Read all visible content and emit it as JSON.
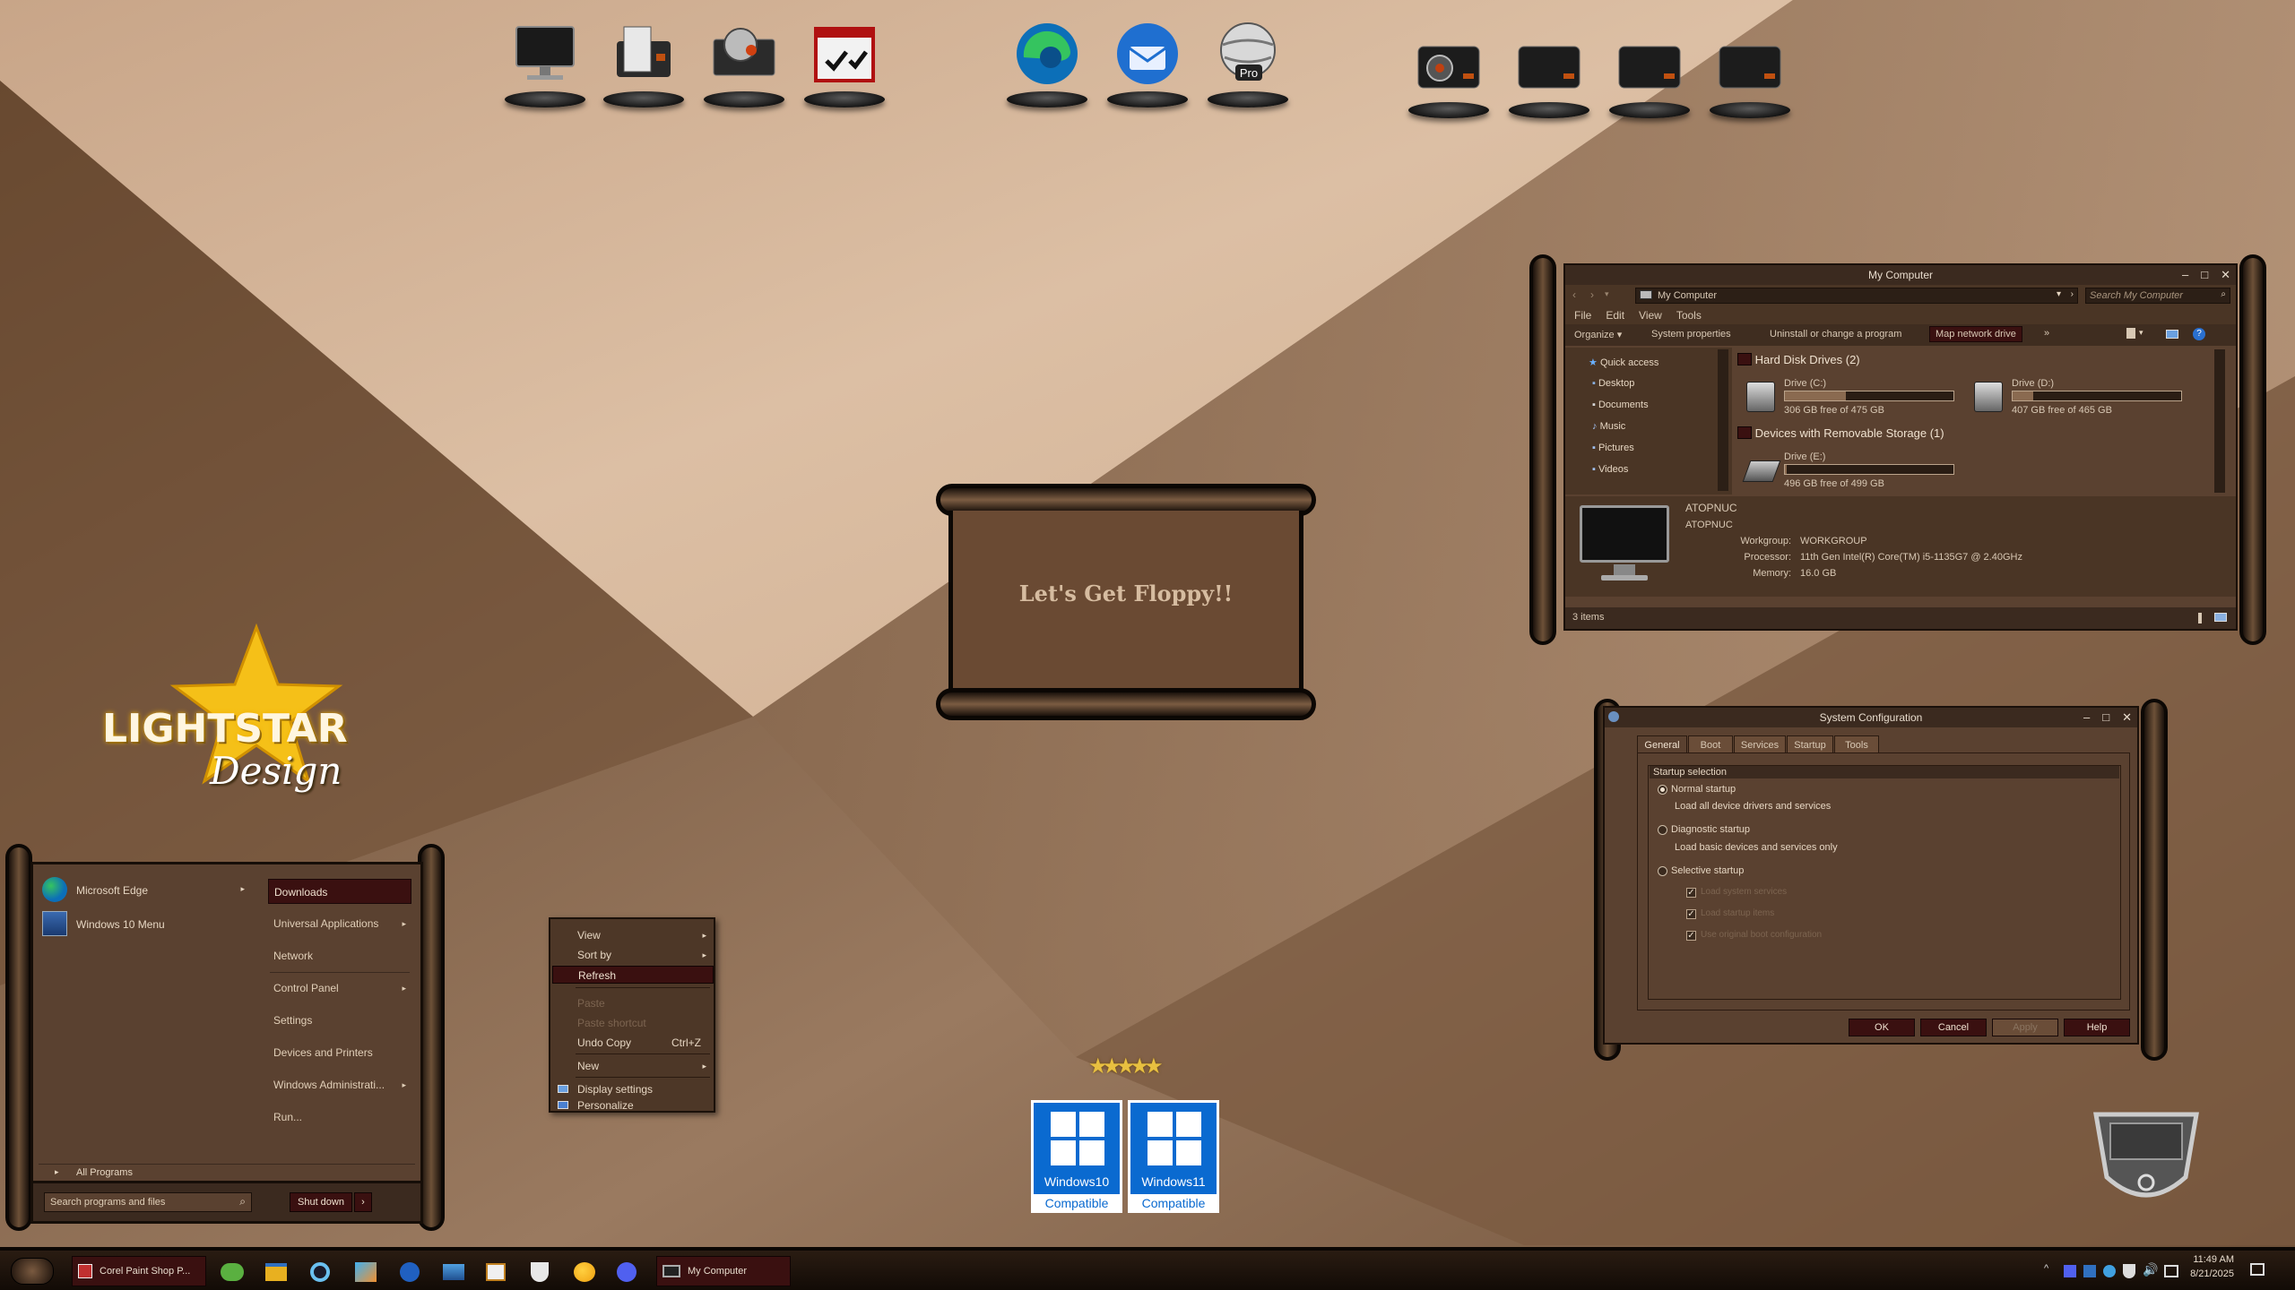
{
  "dock": {
    "left_group": [
      "computer-icon",
      "document-printer-icon",
      "satellite-dish-icon",
      "checklist-app-icon"
    ],
    "center_group": [
      "microsoft-edge-icon",
      "thunderbird-icon",
      "google-earth-pro-icon"
    ],
    "center_labels": {
      "earth_badge": "Pro"
    },
    "right_group": [
      "drive-record-icon",
      "drive-icon",
      "drive-icon",
      "drive-icon"
    ]
  },
  "banner": {
    "text": "Let's Get Floppy!!"
  },
  "logo": {
    "line1": "LIGHTSTAR",
    "line2": "Design"
  },
  "badges": [
    {
      "line1": "Windows10",
      "line2": "Compatible"
    },
    {
      "line1": "Windows11",
      "line2": "Compatible"
    }
  ],
  "explorer": {
    "title": "My Computer",
    "address": "My Computer",
    "search_placeholder": "Search My Computer",
    "menu": [
      "File",
      "Edit",
      "View",
      "Tools"
    ],
    "toolbar": [
      "Organize ▾",
      "System properties",
      "Uninstall or change a program",
      "Map network drive",
      "»"
    ],
    "nav": [
      "Quick access",
      "Desktop",
      "Documents",
      "Music",
      "Pictures",
      "Videos"
    ],
    "group_hdd": "Hard Disk Drives (2)",
    "group_removable": "Devices with Removable Storage (1)",
    "drives": [
      {
        "name": "Drive (C:)",
        "free": "306 GB free of 475 GB",
        "used_fraction": 0.36
      },
      {
        "name": "Drive (D:)",
        "free": "407 GB free of 465 GB",
        "used_fraction": 0.12
      },
      {
        "name": "Drive (E:)",
        "free": "496 GB free of 499 GB",
        "used_fraction": 0.01
      }
    ],
    "details": {
      "pc_name": "ATOPNUC",
      "pc_name2": "ATOPNUC",
      "workgroup_label": "Workgroup:",
      "workgroup": "WORKGROUP",
      "processor_label": "Processor:",
      "processor": "11th Gen Intel(R) Core(TM) i5-1135G7 @ 2.40GHz",
      "memory_label": "Memory:",
      "memory": "16.0 GB"
    },
    "status": "3 items"
  },
  "sysconfig": {
    "title": "System Configuration",
    "tabs": [
      "General",
      "Boot",
      "Services",
      "Startup",
      "Tools"
    ],
    "group_label": "Startup selection",
    "normal": "Normal startup",
    "normal_desc": "Load all device drivers and services",
    "diagnostic": "Diagnostic startup",
    "diagnostic_desc": "Load basic devices and services only",
    "selective": "Selective startup",
    "selective_opts": [
      "Load system services",
      "Load startup items",
      "Use original boot configuration"
    ],
    "buttons": {
      "ok": "OK",
      "cancel": "Cancel",
      "apply": "Apply",
      "help": "Help"
    }
  },
  "start_menu": {
    "pinned": [
      {
        "label": "Microsoft Edge",
        "icon": "microsoft-edge-icon",
        "has_arrow": true
      },
      {
        "label": "Windows 10 Menu",
        "icon": "windows-menu-icon",
        "has_arrow": false
      }
    ],
    "right": [
      {
        "label": "Downloads",
        "arrow": "",
        "highlighted": true
      },
      {
        "label": "Universal Applications",
        "arrow": "▸"
      },
      {
        "label": "Network",
        "arrow": ""
      },
      {
        "label": "Control Panel",
        "arrow": "▸"
      },
      {
        "label": "Settings",
        "arrow": ""
      },
      {
        "label": "Devices and Printers",
        "arrow": ""
      },
      {
        "label": "Windows Administrati...",
        "arrow": "▸"
      },
      {
        "label": "Run...",
        "arrow": ""
      }
    ],
    "all_programs": "All Programs",
    "search_placeholder": "Search programs and files",
    "shutdown": "Shut down"
  },
  "context_menu": {
    "items": [
      {
        "label": "View",
        "arrow": "▸",
        "shortcut": "",
        "disabled": false
      },
      {
        "label": "Sort by",
        "arrow": "▸",
        "shortcut": "",
        "disabled": false
      },
      {
        "label": "Refresh",
        "arrow": "",
        "shortcut": "",
        "disabled": false,
        "highlighted": true
      },
      {
        "label": "Paste",
        "arrow": "",
        "shortcut": "",
        "disabled": true
      },
      {
        "label": "Paste shortcut",
        "arrow": "",
        "shortcut": "",
        "disabled": true
      },
      {
        "label": "Undo Copy",
        "arrow": "",
        "shortcut": "Ctrl+Z",
        "disabled": false
      },
      {
        "label": "New",
        "arrow": "▸",
        "shortcut": "",
        "disabled": false
      },
      {
        "label": "Display settings",
        "arrow": "",
        "shortcut": "",
        "disabled": false
      },
      {
        "label": "Personalize",
        "arrow": "",
        "shortcut": "",
        "disabled": false
      }
    ]
  },
  "taskbar": {
    "corel_label": "Corel Paint Shop P...",
    "mycomputer_label": "My Computer",
    "time": "11:49 AM",
    "date": "8/21/2025"
  },
  "colors": {
    "accent": "#3a1010",
    "window_bg": "#5a4130",
    "frame": "#1a100a",
    "wall_light": "#d9bb9e",
    "wall_dark": "#6b4c33"
  }
}
